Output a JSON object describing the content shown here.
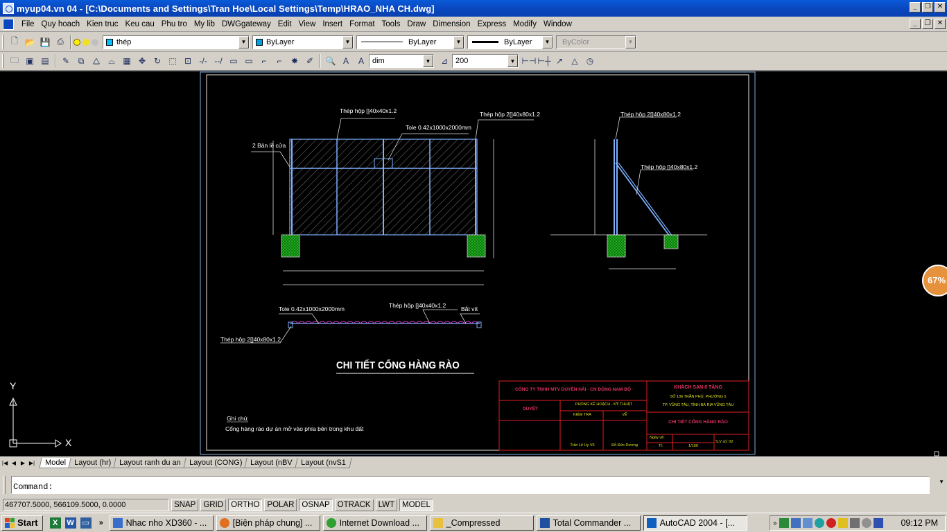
{
  "window": {
    "title": "myup ... AutoCAD 2004 - [C:\\Documents and Settings\\Tran Hoe\\Local Settings\\Temp\\HRAO_NHA CH.dwg]",
    "title_display": "[C:\\Documents and Settings\\Tran Hoe\\Local Settings\\Temp\\HRAO_NHA CH.dwg]",
    "title_prefix": "myup04.vn 04 -"
  },
  "menu": [
    "File",
    "Quy hoach",
    "Kien truc",
    "Keu cau",
    "Phu tro",
    "My lib",
    "DWGgateway",
    "Edit",
    "View",
    "Insert",
    "Format",
    "Tools",
    "Draw",
    "Dimension",
    "Express",
    "Modify",
    "Window"
  ],
  "toolbar": {
    "layer": "thép",
    "color": "ByLayer",
    "linetype": "ByLayer",
    "lineweight": "ByLayer",
    "plotstyle": "ByColor",
    "dimstyle": "dim",
    "scale": "200",
    "colors": {
      "layer_swatch": "#00c0ff",
      "color_swatch": "#00a0e0"
    }
  },
  "drawing": {
    "labels": {
      "thep_hop_40x40_top": "Thép hộp []40x40x1.2",
      "tole_top": "Tole 0.42x1000x2000mm",
      "thep_hop_2_top": "Thép hộp 2[]40x80x1.2",
      "ban_le": "2 Bản lề cửa",
      "side_thep_hop_2": "Thép hộp 2[]40x80x1.2",
      "side_thep_hop": "Thép hộp []40x80x1.2",
      "plan_tole": "Tole 0.42x1000x2000mm",
      "plan_thep_hop": "Thép hộp []40x40x1.2",
      "plan_bat_vit": "Bắt vít",
      "plan_thep_hop_2": "Thép hộp 2[]40x80x1.2"
    },
    "main_title": "CHI TIẾT CỔNG HÀNG RÀO",
    "note_title": "Ghi chú:",
    "note_text": "Cổng hàng rào dự án mở vào phía bên trong khu đất",
    "titleblock": {
      "company": "CÔNG TY TNHH MTV DUYÊN HẢI - CN ĐÔNG NAM BỘ",
      "project": "KHÁCH SẠN 8 TẦNG",
      "address1": "SỐ 106 TRẦN PHÚ, PHƯỜNG 5",
      "address2": "TP. VŨNG TÀU, TỈNH BÀ RỊA VŨNG TÀU",
      "duyet": "DUYỆT",
      "dept": "PHÒNG KẾ HOẠCH - KỸ THUẬT",
      "kiem_tra": "KIỂM TRA",
      "ve": "VẼ",
      "sheet_title": "CHI TIẾT CỔNG HÀNG RÀO",
      "checker": "Trần Lê Uy Vũ",
      "drafter": "Đỗ Đức Dương",
      "ngay_ve": "Ngày vẽ:",
      "ti_le": "Tỉ:",
      "scale": "1/100",
      "sheet_no": "S.V số: 02"
    },
    "ucs": {
      "x": "X",
      "y": "Y"
    }
  },
  "zoom_badge": "67%",
  "tabs": [
    "Model",
    "Layout (hr)",
    "Layout ranh du an",
    "Layout (CONG)",
    "Layout (nBV",
    "Layout (nvS1"
  ],
  "command": {
    "prompt": "Command:"
  },
  "status": {
    "coords": "467707.5000, 566109.5000, 0.0000",
    "toggles": [
      {
        "label": "SNAP",
        "on": false
      },
      {
        "label": "GRID",
        "on": false
      },
      {
        "label": "ORTHO",
        "on": true
      },
      {
        "label": "POLAR",
        "on": false
      },
      {
        "label": "OSNAP",
        "on": true
      },
      {
        "label": "OTRACK",
        "on": false
      },
      {
        "label": "LWT",
        "on": false
      },
      {
        "label": "MODEL",
        "on": true
      }
    ]
  },
  "taskbar": {
    "start": "Start",
    "buttons": [
      {
        "label": "Nhac nho XD360 - ...",
        "icon_color": "#3a6ec8"
      },
      {
        "label": "[Biện pháp chung] ...",
        "icon_color": "#e07020"
      },
      {
        "label": "Internet Download ...",
        "icon_color": "#30a030"
      },
      {
        "label": "_Compressed",
        "icon_color": "#e8c040"
      },
      {
        "label": "Total Commander ...",
        "icon_color": "#2050a0"
      },
      {
        "label": "AutoCAD 2004 - [...",
        "icon_color": "#1060c0",
        "active": true
      }
    ],
    "clock": "09:12 PM"
  }
}
